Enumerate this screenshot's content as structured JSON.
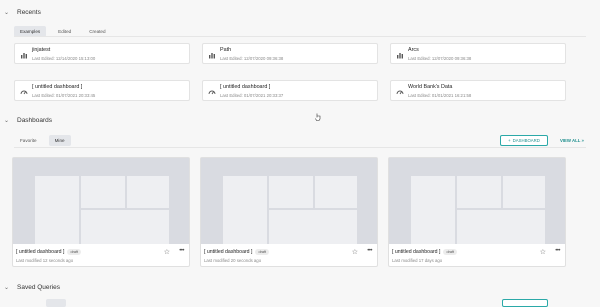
{
  "recents": {
    "title": "Recents",
    "tabs": [
      "Examples",
      "Edited",
      "Created"
    ],
    "items": [
      {
        "icon": "bar-chart-icon",
        "title": "jinjatest",
        "subtitle": "Last Edited: 12/14/2020 15:13:00"
      },
      {
        "icon": "bar-chart-icon",
        "title": "Path",
        "subtitle": "Last Edited: 12/07/2020 09:36:38"
      },
      {
        "icon": "bar-chart-icon",
        "title": "Arcs",
        "subtitle": "Last Edited: 12/07/2020 09:36:38"
      },
      {
        "icon": "dashboard-gauge-icon",
        "title": "[ untitled dashboard ]",
        "subtitle": "Last Edited: 01/07/2021 20:33:45"
      },
      {
        "icon": "dashboard-gauge-icon",
        "title": "[ untitled dashboard ]",
        "subtitle": "Last Edited: 01/07/2021 20:33:37"
      },
      {
        "icon": "dashboard-gauge-icon",
        "title": "World Bank's Data",
        "subtitle": "Last Edited: 01/01/2021 16:21:58"
      }
    ]
  },
  "dashboards": {
    "title": "Dashboards",
    "tabs": [
      "Favorite",
      "Mine"
    ],
    "add_button": "DASHBOARD",
    "view_all": "VIEW ALL »",
    "items": [
      {
        "title": "[ untitled dashboard ]",
        "badge": "draft",
        "modified": "Last modified 12 seconds ago"
      },
      {
        "title": "[ untitled dashboard ]",
        "badge": "draft",
        "modified": "Last modified 20 seconds ago"
      },
      {
        "title": "[ untitled dashboard ]",
        "badge": "draft",
        "modified": "Last modified 17 days ago"
      }
    ]
  },
  "saved_queries": {
    "title": "Saved Queries"
  }
}
